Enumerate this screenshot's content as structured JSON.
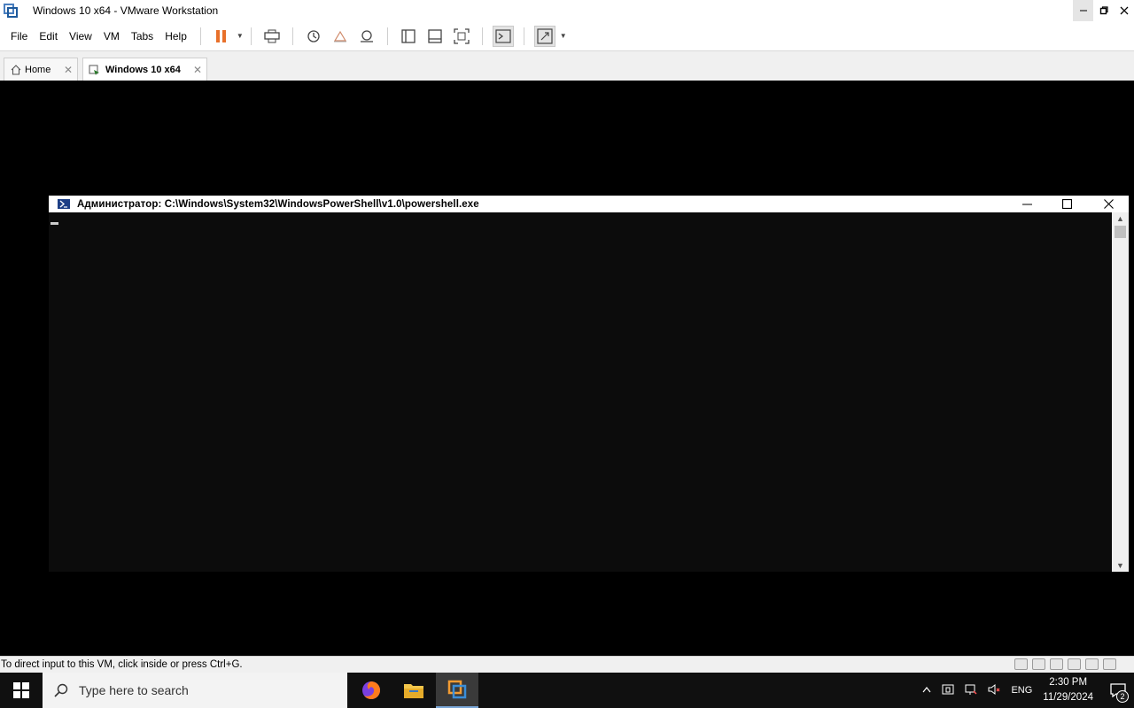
{
  "window": {
    "title": "Windows 10 x64 - VMware Workstation",
    "controls": [
      "minimize",
      "restore",
      "close"
    ]
  },
  "menu": {
    "items": [
      {
        "label": "File"
      },
      {
        "label": "Edit"
      },
      {
        "label": "View"
      },
      {
        "label": "VM"
      },
      {
        "label": "Tabs"
      },
      {
        "label": "Help"
      }
    ]
  },
  "toolbar": {
    "buttons": [
      "pause-icon",
      "send-ctrl-alt-del-icon",
      "snapshot-take-icon",
      "snapshot-revert-icon",
      "snapshot-manager-icon",
      "library-icon",
      "thumbnail-bar-icon",
      "full-screen-icon",
      "console-view-icon",
      "stretch-guest-icon"
    ]
  },
  "tabs": [
    {
      "label": "Home",
      "active": false
    },
    {
      "label": "Windows 10 x64",
      "active": true
    }
  ],
  "powershell": {
    "title": "Администратор: C:\\Windows\\System32\\WindowsPowerShell\\v1.0\\powershell.exe",
    "background": "#0c0c0c"
  },
  "status": {
    "text": "To direct input to this VM, click inside or press Ctrl+G."
  },
  "taskbar": {
    "search_placeholder": "Type here to search",
    "language": "ENG",
    "time": "2:30 PM",
    "date": "11/29/2024",
    "notification_count": "2",
    "apps": [
      "firefox-icon",
      "file-explorer-icon",
      "vmware-icon"
    ]
  },
  "colors": {
    "accent": "#e8702a",
    "taskbar": "#101010",
    "vm_background": "#000000"
  }
}
